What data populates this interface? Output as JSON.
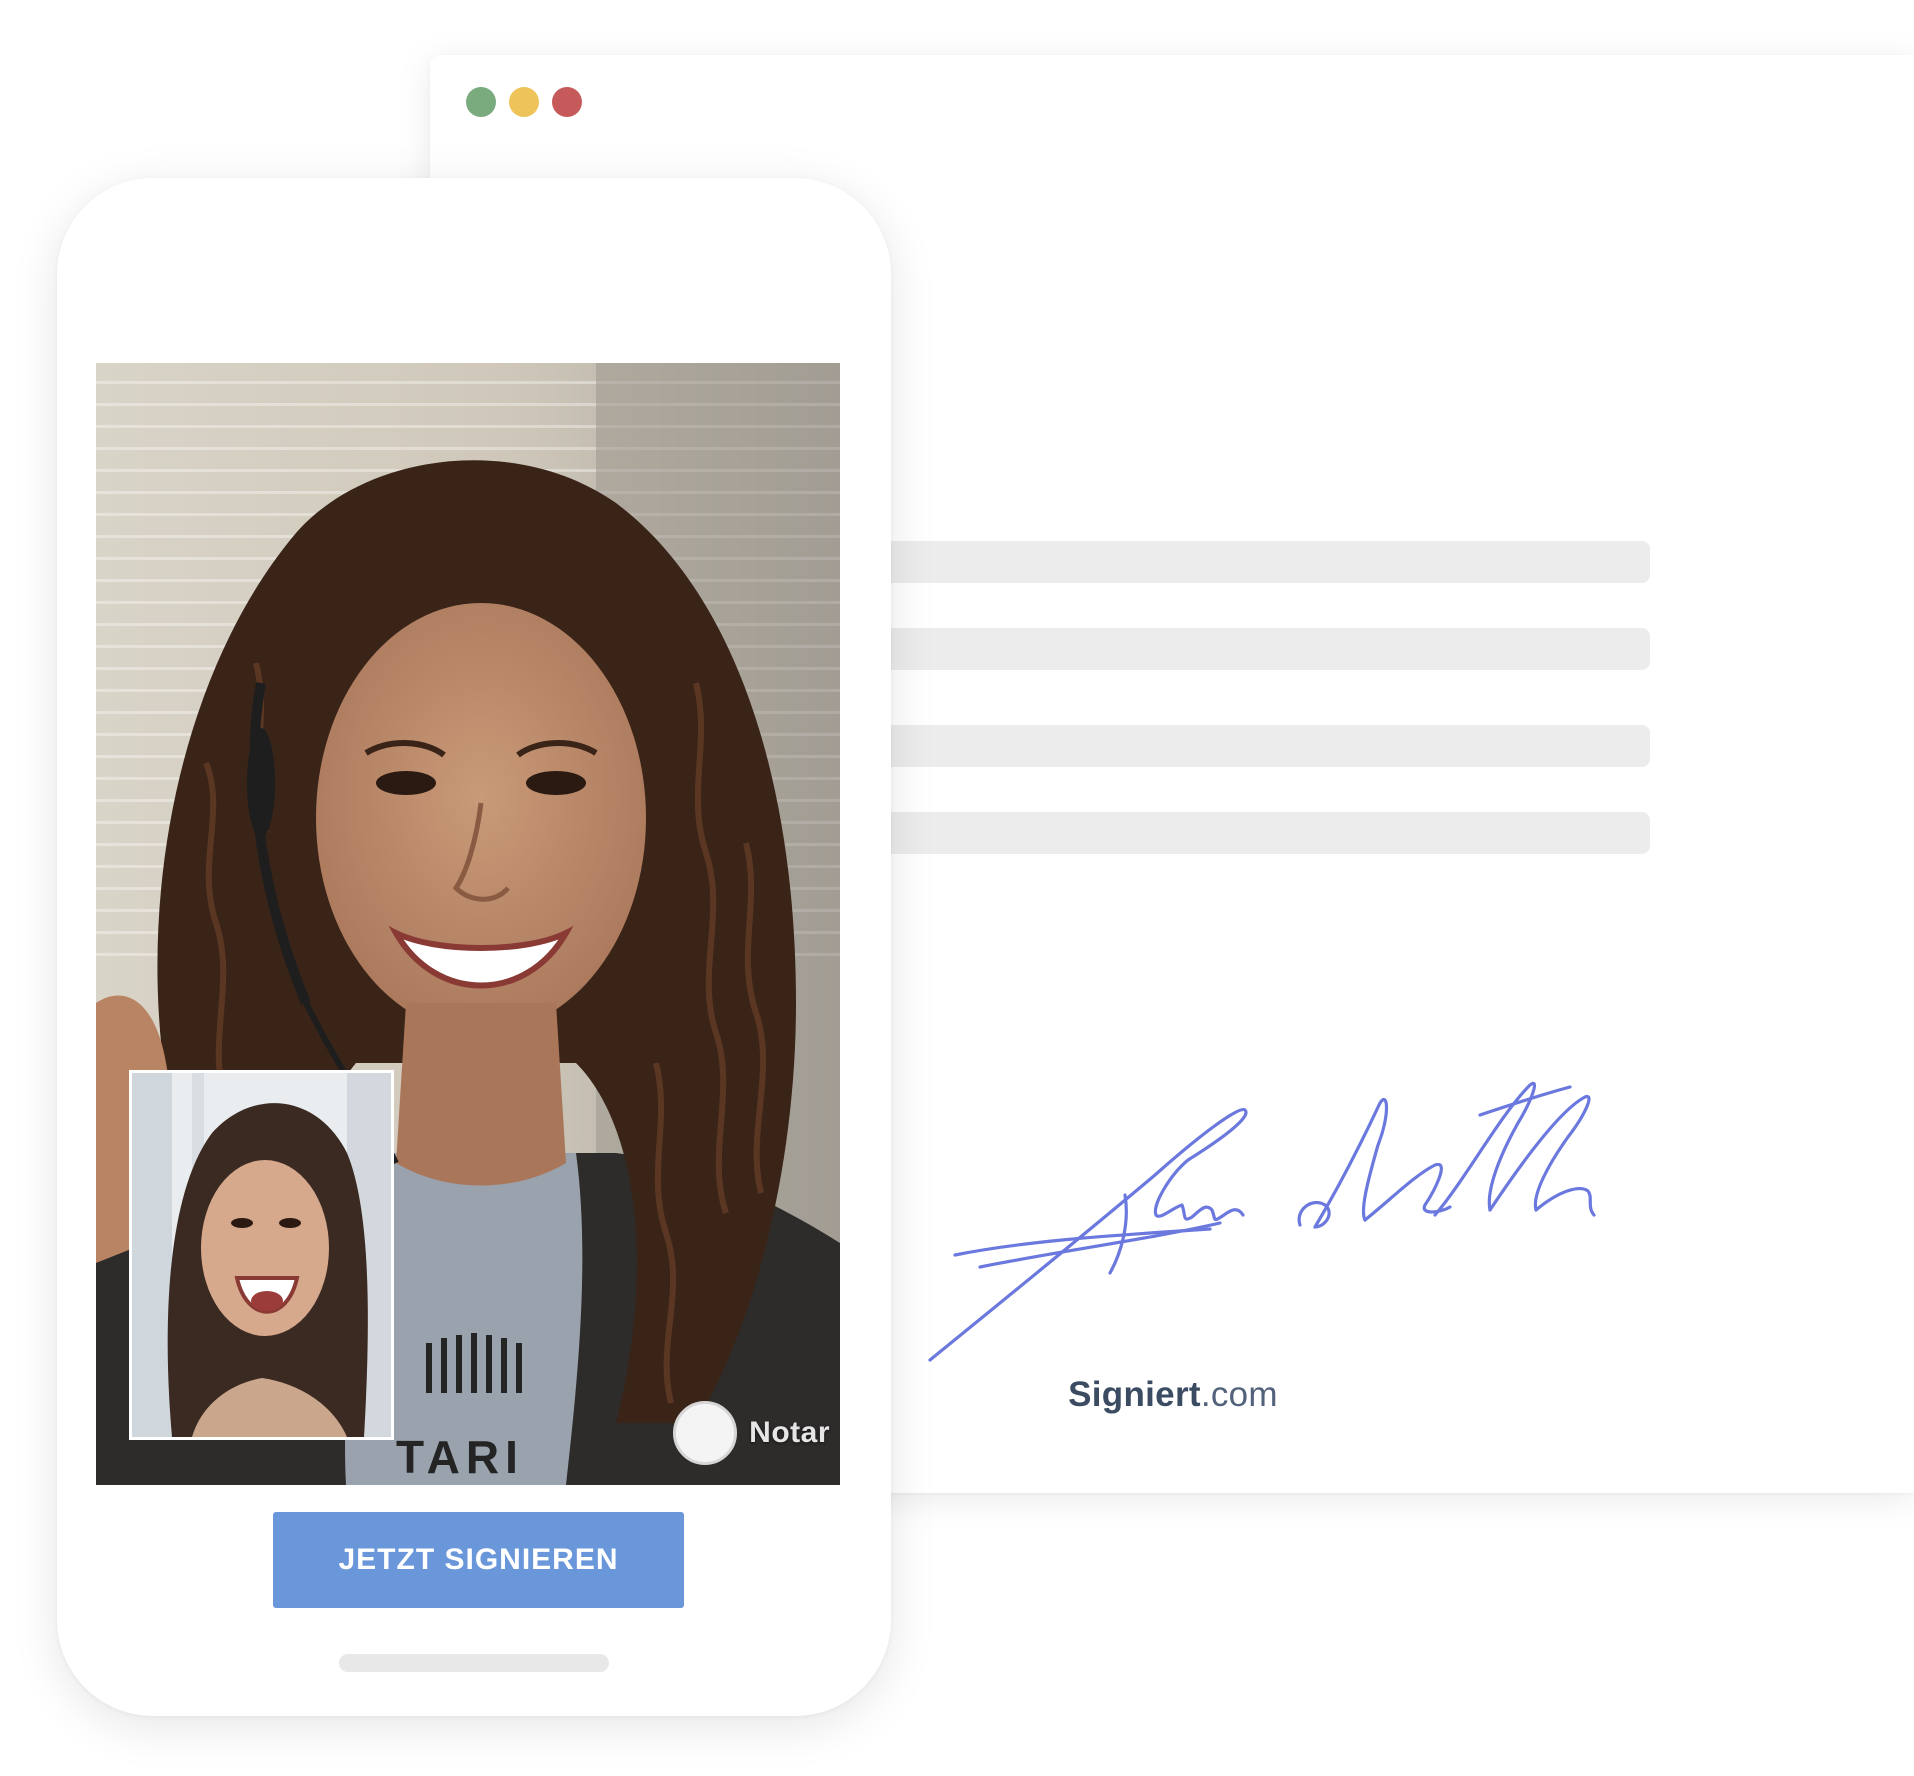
{
  "browser_window": {
    "traffic_lights": [
      {
        "name": "green",
        "color": "#7aab7f"
      },
      {
        "name": "yellow",
        "color": "#eec45a"
      },
      {
        "name": "red",
        "color": "#c65a5a"
      }
    ],
    "document_placeholder_lines": 4,
    "signature_color": "#6b78de",
    "brand": {
      "bold_text": "Signiert",
      "light_text": ".com",
      "color": "#3b4c62"
    }
  },
  "phone": {
    "video_call": {
      "watermark_text": "Notar",
      "shirt_text": "TARI"
    },
    "sign_button_label": "JETZT SIGNIEREN",
    "accent_color": "#6a97da"
  }
}
